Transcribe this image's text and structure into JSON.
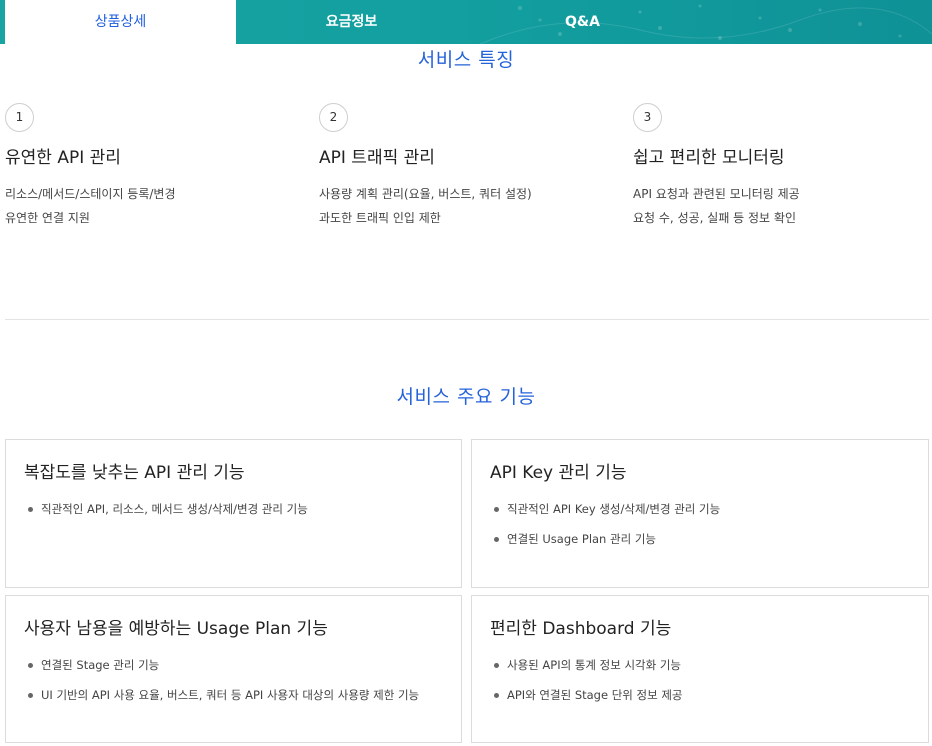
{
  "tabs": [
    {
      "label": "상품상세",
      "active": true
    },
    {
      "label": "요금정보",
      "active": false
    },
    {
      "label": "Q&A",
      "active": false
    }
  ],
  "features_section": {
    "title": "서비스 특징",
    "items": [
      {
        "number": "1",
        "title": "유연한 API 관리",
        "lines": [
          "리소스/메서드/스테이지 등록/변경",
          "유연한 연결 지원"
        ]
      },
      {
        "number": "2",
        "title": "API 트래픽 관리",
        "lines": [
          "사용량 계획 관리(요율, 버스트, 쿼터 설정)",
          "과도한 트래픽 인입 제한"
        ]
      },
      {
        "number": "3",
        "title": "쉽고 편리한 모니터링",
        "lines": [
          "API 요청과 관련된 모니터링 제공",
          "요청 수, 성공, 실패 등 정보 확인"
        ]
      }
    ]
  },
  "functions_section": {
    "title": "서비스 주요 기능",
    "cards": [
      {
        "title": "복잡도를 낮추는 API 관리 기능",
        "bullets": [
          "직관적인 API, 리소스, 메서드 생성/삭제/변경 관리 기능"
        ]
      },
      {
        "title": "API Key 관리 기능",
        "bullets": [
          "직관적인 API Key 생성/삭제/변경 관리 기능",
          "연결된 Usage Plan 관리 기능"
        ]
      },
      {
        "title": "사용자 남용을 예방하는 Usage Plan 기능",
        "bullets": [
          "연결된 Stage 관리 기능",
          "UI 기반의 API 사용 요율, 버스트, 쿼터 등 API 사용자 대상의 사용량 제한 기능"
        ]
      },
      {
        "title": "편리한 Dashboard 기능",
        "bullets": [
          "사용된 API의 통계 정보 시각화 기능",
          "API와 연결된 Stage 단위 정보 제공"
        ]
      }
    ]
  },
  "colors": {
    "accent_blue": "#2563d9",
    "tab_teal": "#14a0a0"
  }
}
